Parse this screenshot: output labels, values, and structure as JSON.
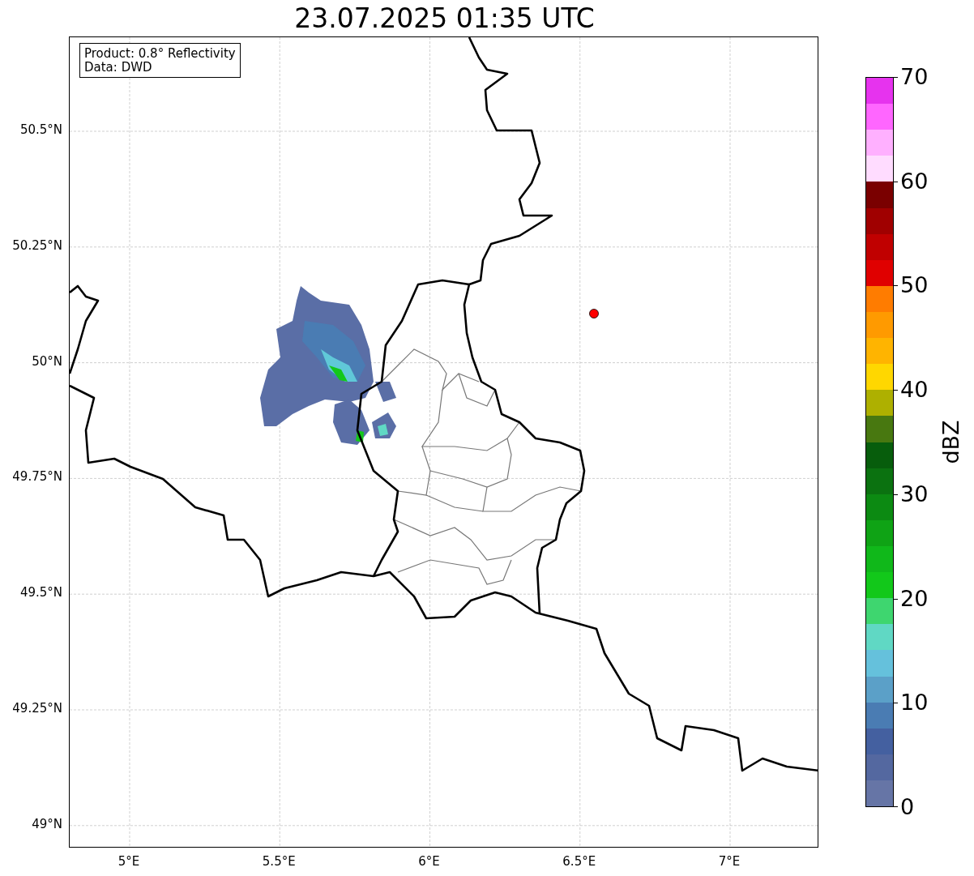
{
  "title": "23.07.2025 01:35 UTC",
  "info_box": [
    "Product: 0.8° Reflectivity",
    "Data: DWD"
  ],
  "map": {
    "xticks": [
      "5°E",
      "5.5°E",
      "6°E",
      "6.5°E",
      "7°E"
    ],
    "yticks": [
      "50.5°N",
      "50.25°N",
      "50°N",
      "49.75°N",
      "49.5°N",
      "49.25°N",
      "49°N"
    ]
  },
  "colorbar": {
    "label": "dBZ",
    "ticks": [
      "70",
      "60",
      "50",
      "40",
      "30",
      "20",
      "10",
      "0"
    ],
    "segments": [
      {
        "color": "#e633ee"
      },
      {
        "color": "#ff66ff"
      },
      {
        "color": "#ffb0ff"
      },
      {
        "color": "#ffdcff"
      },
      {
        "color": "#7a0000"
      },
      {
        "color": "#a00000"
      },
      {
        "color": "#c00000"
      },
      {
        "color": "#e00000"
      },
      {
        "color": "#ff7c00"
      },
      {
        "color": "#ff9a00"
      },
      {
        "color": "#ffb400"
      },
      {
        "color": "#ffd700"
      },
      {
        "color": "#aeb000"
      },
      {
        "color": "#487810"
      },
      {
        "color": "#075d0c"
      },
      {
        "color": "#0b7210"
      },
      {
        "color": "#0c8a12"
      },
      {
        "color": "#0fa315"
      },
      {
        "color": "#10b81a"
      },
      {
        "color": "#12c81a"
      },
      {
        "color": "#3ed66f"
      },
      {
        "color": "#60d8c4"
      },
      {
        "color": "#65c1dc"
      },
      {
        "color": "#5ba0c8"
      },
      {
        "color": "#4a7cb3"
      },
      {
        "color": "#4460a0"
      },
      {
        "color": "#5468a0"
      },
      {
        "color": "#6675a6"
      }
    ]
  }
}
